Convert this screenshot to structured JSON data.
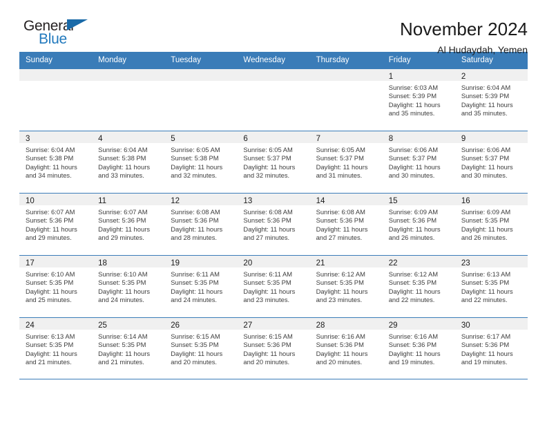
{
  "brand": {
    "name_part1": "General",
    "name_part2": "Blue",
    "accent_color": "#2179bd",
    "flag_icon": "triangle-flag-icon"
  },
  "header": {
    "title": "November 2024",
    "subtitle": "Al Hudaydah, Yemen"
  },
  "colors": {
    "header_band": "#3a7cb8",
    "daynum_band": "#f0f0f0",
    "text": "#1a1a1a"
  },
  "weekdays": [
    "Sunday",
    "Monday",
    "Tuesday",
    "Wednesday",
    "Thursday",
    "Friday",
    "Saturday"
  ],
  "weeks": [
    [
      {
        "day": "",
        "empty": true
      },
      {
        "day": "",
        "empty": true
      },
      {
        "day": "",
        "empty": true
      },
      {
        "day": "",
        "empty": true
      },
      {
        "day": "",
        "empty": true
      },
      {
        "day": "1",
        "sunrise": "Sunrise: 6:03 AM",
        "sunset": "Sunset: 5:39 PM",
        "daylight_line1": "Daylight: 11 hours",
        "daylight_line2": "and 35 minutes."
      },
      {
        "day": "2",
        "sunrise": "Sunrise: 6:04 AM",
        "sunset": "Sunset: 5:39 PM",
        "daylight_line1": "Daylight: 11 hours",
        "daylight_line2": "and 35 minutes."
      }
    ],
    [
      {
        "day": "3",
        "sunrise": "Sunrise: 6:04 AM",
        "sunset": "Sunset: 5:38 PM",
        "daylight_line1": "Daylight: 11 hours",
        "daylight_line2": "and 34 minutes."
      },
      {
        "day": "4",
        "sunrise": "Sunrise: 6:04 AM",
        "sunset": "Sunset: 5:38 PM",
        "daylight_line1": "Daylight: 11 hours",
        "daylight_line2": "and 33 minutes."
      },
      {
        "day": "5",
        "sunrise": "Sunrise: 6:05 AM",
        "sunset": "Sunset: 5:38 PM",
        "daylight_line1": "Daylight: 11 hours",
        "daylight_line2": "and 32 minutes."
      },
      {
        "day": "6",
        "sunrise": "Sunrise: 6:05 AM",
        "sunset": "Sunset: 5:37 PM",
        "daylight_line1": "Daylight: 11 hours",
        "daylight_line2": "and 32 minutes."
      },
      {
        "day": "7",
        "sunrise": "Sunrise: 6:05 AM",
        "sunset": "Sunset: 5:37 PM",
        "daylight_line1": "Daylight: 11 hours",
        "daylight_line2": "and 31 minutes."
      },
      {
        "day": "8",
        "sunrise": "Sunrise: 6:06 AM",
        "sunset": "Sunset: 5:37 PM",
        "daylight_line1": "Daylight: 11 hours",
        "daylight_line2": "and 30 minutes."
      },
      {
        "day": "9",
        "sunrise": "Sunrise: 6:06 AM",
        "sunset": "Sunset: 5:37 PM",
        "daylight_line1": "Daylight: 11 hours",
        "daylight_line2": "and 30 minutes."
      }
    ],
    [
      {
        "day": "10",
        "sunrise": "Sunrise: 6:07 AM",
        "sunset": "Sunset: 5:36 PM",
        "daylight_line1": "Daylight: 11 hours",
        "daylight_line2": "and 29 minutes."
      },
      {
        "day": "11",
        "sunrise": "Sunrise: 6:07 AM",
        "sunset": "Sunset: 5:36 PM",
        "daylight_line1": "Daylight: 11 hours",
        "daylight_line2": "and 29 minutes."
      },
      {
        "day": "12",
        "sunrise": "Sunrise: 6:08 AM",
        "sunset": "Sunset: 5:36 PM",
        "daylight_line1": "Daylight: 11 hours",
        "daylight_line2": "and 28 minutes."
      },
      {
        "day": "13",
        "sunrise": "Sunrise: 6:08 AM",
        "sunset": "Sunset: 5:36 PM",
        "daylight_line1": "Daylight: 11 hours",
        "daylight_line2": "and 27 minutes."
      },
      {
        "day": "14",
        "sunrise": "Sunrise: 6:08 AM",
        "sunset": "Sunset: 5:36 PM",
        "daylight_line1": "Daylight: 11 hours",
        "daylight_line2": "and 27 minutes."
      },
      {
        "day": "15",
        "sunrise": "Sunrise: 6:09 AM",
        "sunset": "Sunset: 5:36 PM",
        "daylight_line1": "Daylight: 11 hours",
        "daylight_line2": "and 26 minutes."
      },
      {
        "day": "16",
        "sunrise": "Sunrise: 6:09 AM",
        "sunset": "Sunset: 5:35 PM",
        "daylight_line1": "Daylight: 11 hours",
        "daylight_line2": "and 26 minutes."
      }
    ],
    [
      {
        "day": "17",
        "sunrise": "Sunrise: 6:10 AM",
        "sunset": "Sunset: 5:35 PM",
        "daylight_line1": "Daylight: 11 hours",
        "daylight_line2": "and 25 minutes."
      },
      {
        "day": "18",
        "sunrise": "Sunrise: 6:10 AM",
        "sunset": "Sunset: 5:35 PM",
        "daylight_line1": "Daylight: 11 hours",
        "daylight_line2": "and 24 minutes."
      },
      {
        "day": "19",
        "sunrise": "Sunrise: 6:11 AM",
        "sunset": "Sunset: 5:35 PM",
        "daylight_line1": "Daylight: 11 hours",
        "daylight_line2": "and 24 minutes."
      },
      {
        "day": "20",
        "sunrise": "Sunrise: 6:11 AM",
        "sunset": "Sunset: 5:35 PM",
        "daylight_line1": "Daylight: 11 hours",
        "daylight_line2": "and 23 minutes."
      },
      {
        "day": "21",
        "sunrise": "Sunrise: 6:12 AM",
        "sunset": "Sunset: 5:35 PM",
        "daylight_line1": "Daylight: 11 hours",
        "daylight_line2": "and 23 minutes."
      },
      {
        "day": "22",
        "sunrise": "Sunrise: 6:12 AM",
        "sunset": "Sunset: 5:35 PM",
        "daylight_line1": "Daylight: 11 hours",
        "daylight_line2": "and 22 minutes."
      },
      {
        "day": "23",
        "sunrise": "Sunrise: 6:13 AM",
        "sunset": "Sunset: 5:35 PM",
        "daylight_line1": "Daylight: 11 hours",
        "daylight_line2": "and 22 minutes."
      }
    ],
    [
      {
        "day": "24",
        "sunrise": "Sunrise: 6:13 AM",
        "sunset": "Sunset: 5:35 PM",
        "daylight_line1": "Daylight: 11 hours",
        "daylight_line2": "and 21 minutes."
      },
      {
        "day": "25",
        "sunrise": "Sunrise: 6:14 AM",
        "sunset": "Sunset: 5:35 PM",
        "daylight_line1": "Daylight: 11 hours",
        "daylight_line2": "and 21 minutes."
      },
      {
        "day": "26",
        "sunrise": "Sunrise: 6:15 AM",
        "sunset": "Sunset: 5:35 PM",
        "daylight_line1": "Daylight: 11 hours",
        "daylight_line2": "and 20 minutes."
      },
      {
        "day": "27",
        "sunrise": "Sunrise: 6:15 AM",
        "sunset": "Sunset: 5:36 PM",
        "daylight_line1": "Daylight: 11 hours",
        "daylight_line2": "and 20 minutes."
      },
      {
        "day": "28",
        "sunrise": "Sunrise: 6:16 AM",
        "sunset": "Sunset: 5:36 PM",
        "daylight_line1": "Daylight: 11 hours",
        "daylight_line2": "and 20 minutes."
      },
      {
        "day": "29",
        "sunrise": "Sunrise: 6:16 AM",
        "sunset": "Sunset: 5:36 PM",
        "daylight_line1": "Daylight: 11 hours",
        "daylight_line2": "and 19 minutes."
      },
      {
        "day": "30",
        "sunrise": "Sunrise: 6:17 AM",
        "sunset": "Sunset: 5:36 PM",
        "daylight_line1": "Daylight: 11 hours",
        "daylight_line2": "and 19 minutes."
      }
    ]
  ]
}
